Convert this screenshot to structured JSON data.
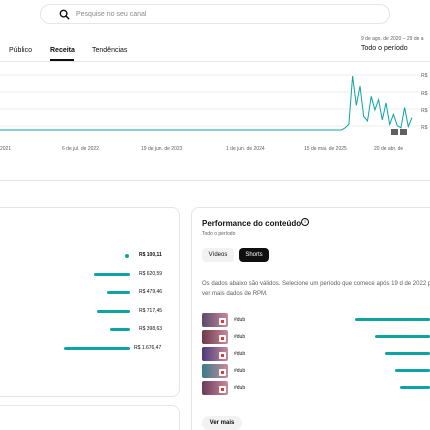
{
  "search": {
    "placeholder": "Pesquise no seu canal",
    "icon": "search-icon"
  },
  "tabs": [
    {
      "label": "Público",
      "active": false
    },
    {
      "label": "Receita",
      "active": true
    },
    {
      "label": "Tendências",
      "active": false
    }
  ],
  "date_range": {
    "dates": "9 de ago. de 2020 – 29 de a",
    "label": "Todo o período"
  },
  "chart_data": {
    "type": "line",
    "x_tick_labels": [
      "2021",
      "6 de jul. de 2022",
      "19 de jun. de 2023",
      "1 de jun. de 2024",
      "15 de mai. de 2025",
      "20 de abr. de"
    ],
    "y_tick_labels": [
      "R$",
      "R$",
      "R$",
      "R$"
    ],
    "series": [
      {
        "values": [
          0,
          0,
          0,
          0,
          0,
          0,
          0,
          0,
          0,
          0,
          0,
          0,
          0,
          0,
          0,
          0,
          0,
          0,
          0,
          0,
          0,
          0,
          0,
          0,
          0,
          0,
          0,
          0,
          0,
          0,
          0,
          0,
          0,
          0,
          0,
          0,
          0,
          0,
          0,
          0,
          0,
          0,
          0,
          0,
          0,
          0,
          0,
          0,
          0,
          0,
          0,
          0,
          0,
          0,
          0,
          0,
          0,
          0,
          0,
          0,
          0,
          0,
          0,
          0,
          0,
          0,
          0,
          0,
          0,
          0,
          0,
          0,
          0,
          0,
          0,
          0,
          0,
          0,
          0,
          0,
          0,
          0,
          0,
          0,
          0,
          0,
          0,
          0,
          0,
          0,
          0,
          0,
          0,
          2,
          5,
          48,
          22,
          39,
          12,
          8,
          30,
          18,
          27,
          9,
          24,
          5,
          14,
          4,
          2,
          20,
          3,
          11
        ]
      }
    ],
    "line_color": "#0fa3a3",
    "grid": true
  },
  "performance": {
    "title": "Performance do conteúdo",
    "subtitle": "Todo o período",
    "chips": [
      "Vídeos",
      "Shorts"
    ],
    "active_chip": "Shorts",
    "message": "Os dados abaixo são válidos. Selecione um período que comece após 19 d de 2022 para ver mais dados de RPM.",
    "rows": [
      {
        "label": "#dub",
        "value": 0.75
      },
      {
        "label": "#dub",
        "value": 0.55
      },
      {
        "label": "#dub",
        "value": 0.45
      },
      {
        "label": "#dub",
        "value": 0.35
      },
      {
        "label": "#dub",
        "value": 0.3
      }
    ],
    "more_label": "Ver mais"
  },
  "revenue_rows": [
    {
      "value": "R$ 100,11",
      "bar": 0.0
    },
    {
      "value": "R$ 620,59",
      "bar": 0.55
    },
    {
      "value": "R$ 479,46",
      "bar": 0.35
    },
    {
      "value": "R$ 717,45",
      "bar": 0.5
    },
    {
      "value": "R$ 398,63",
      "bar": 0.3
    },
    {
      "value": "R$ 1.676,47",
      "bar": 1.0
    }
  ],
  "colors": {
    "accent": "#0fa3a3"
  }
}
